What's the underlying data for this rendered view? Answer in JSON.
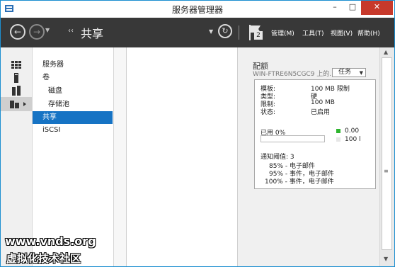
{
  "window": {
    "title": "服务器管理器",
    "controls": {
      "minimize": "–",
      "maximize": "□",
      "close": "✕"
    }
  },
  "header": {
    "breadcrumb_arrows": "‹‹",
    "breadcrumb": "共享",
    "notification_count": "2",
    "menus": [
      "管理(M)",
      "工具(T)",
      "视图(V)",
      "帮助(H)"
    ]
  },
  "icon_strip": [
    "dashboard-icon",
    "local-server-icon",
    "all-servers-icon",
    "file-storage-icon"
  ],
  "nav": {
    "items": [
      {
        "label": "服务器",
        "selected": false,
        "indent": false
      },
      {
        "label": "卷",
        "selected": false,
        "indent": false
      },
      {
        "label": "磁盘",
        "selected": false,
        "indent": true
      },
      {
        "label": "存储池",
        "selected": false,
        "indent": true
      },
      {
        "label": "共享",
        "selected": true,
        "indent": false
      },
      {
        "label": "iSCSI",
        "selected": false,
        "indent": false
      }
    ]
  },
  "quota": {
    "title": "配额",
    "server": "WIN-FTRE6N5CGC9 上的...",
    "tasks_label": "任务",
    "properties": [
      {
        "label": "模板:",
        "value": "100 MB 限制"
      },
      {
        "label": "类型:",
        "value": "硬"
      },
      {
        "label": "限制:",
        "value": "100 MB"
      },
      {
        "label": "状态:",
        "value": "已启用"
      }
    ],
    "usage_label": "已用 0%",
    "usage_fraction": 0.0,
    "legend": [
      {
        "value": "0.00",
        "color": "#2fb52f"
      },
      {
        "value": "100 l",
        "color": "#e6e6e6"
      }
    ],
    "threshold_label": "通知阈值: 3",
    "thresholds": [
      "85% - 电子邮件",
      "95% - 事件，电子邮件",
      "100% - 事件，电子邮件"
    ]
  },
  "watermark": {
    "site": "www.vnds.org",
    "community": "虚拟化技术社区"
  }
}
